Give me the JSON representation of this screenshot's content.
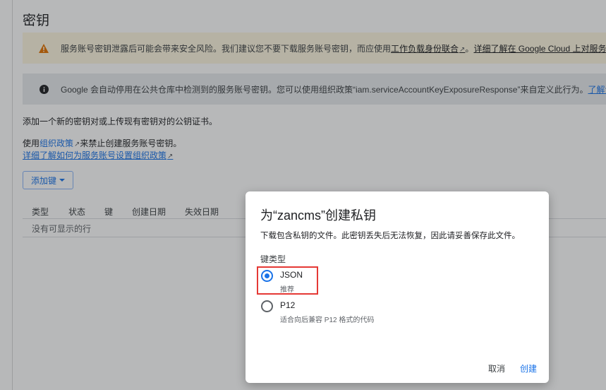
{
  "page": {
    "title": "密钥",
    "warning": {
      "text": "服务账号密钥泄露后可能会带来安全风险。我们建议您不要下载服务账号密钥，而应使用",
      "link1": "工作负载身份联合",
      "sep": "。",
      "link2": "详细了解在 Google Cloud 上对服务"
    },
    "info": {
      "text": "Google 会自动停用在公共仓库中检测到的服务账号密钥。您可以使用组织政策“iam.serviceAccountKeyExposureResponse”来自定义此行为。",
      "link": "了解详"
    },
    "intro": "添加一个新的密钥对或上传现有密钥对的公钥证书。",
    "policy_prefix": "使用",
    "policy_link": "组织政策",
    "policy_suffix": "来禁止创建服务账号密钥。",
    "learn_more": "详细了解如何为服务账号设置组织政策",
    "add_key": "添加键",
    "table": {
      "headers": [
        "类型",
        "状态",
        "键",
        "创建日期",
        "失效日期"
      ],
      "empty": "没有可显示的行"
    }
  },
  "dialog": {
    "title": "为“zancms”创建私钥",
    "description": "下载包含私钥的文件。此密钥丢失后无法恢复，因此请妥善保存此文件。",
    "key_type_label": "键类型",
    "options": [
      {
        "label": "JSON",
        "hint": "推荐",
        "selected": true
      },
      {
        "label": "P12",
        "hint": "适合向后兼容 P12 格式的代码",
        "selected": false
      }
    ],
    "cancel": "取消",
    "create": "创建"
  },
  "colors": {
    "accent": "#1a73e8",
    "warning_bg": "#fef7e0",
    "warning_icon": "#e37400",
    "info_bg": "#e8eaed",
    "highlight": "#e53935"
  },
  "icons": {
    "warning": "warning-triangle-icon",
    "info": "info-circle-icon",
    "external": "external-link-icon",
    "dropdown": "caret-down-icon"
  }
}
